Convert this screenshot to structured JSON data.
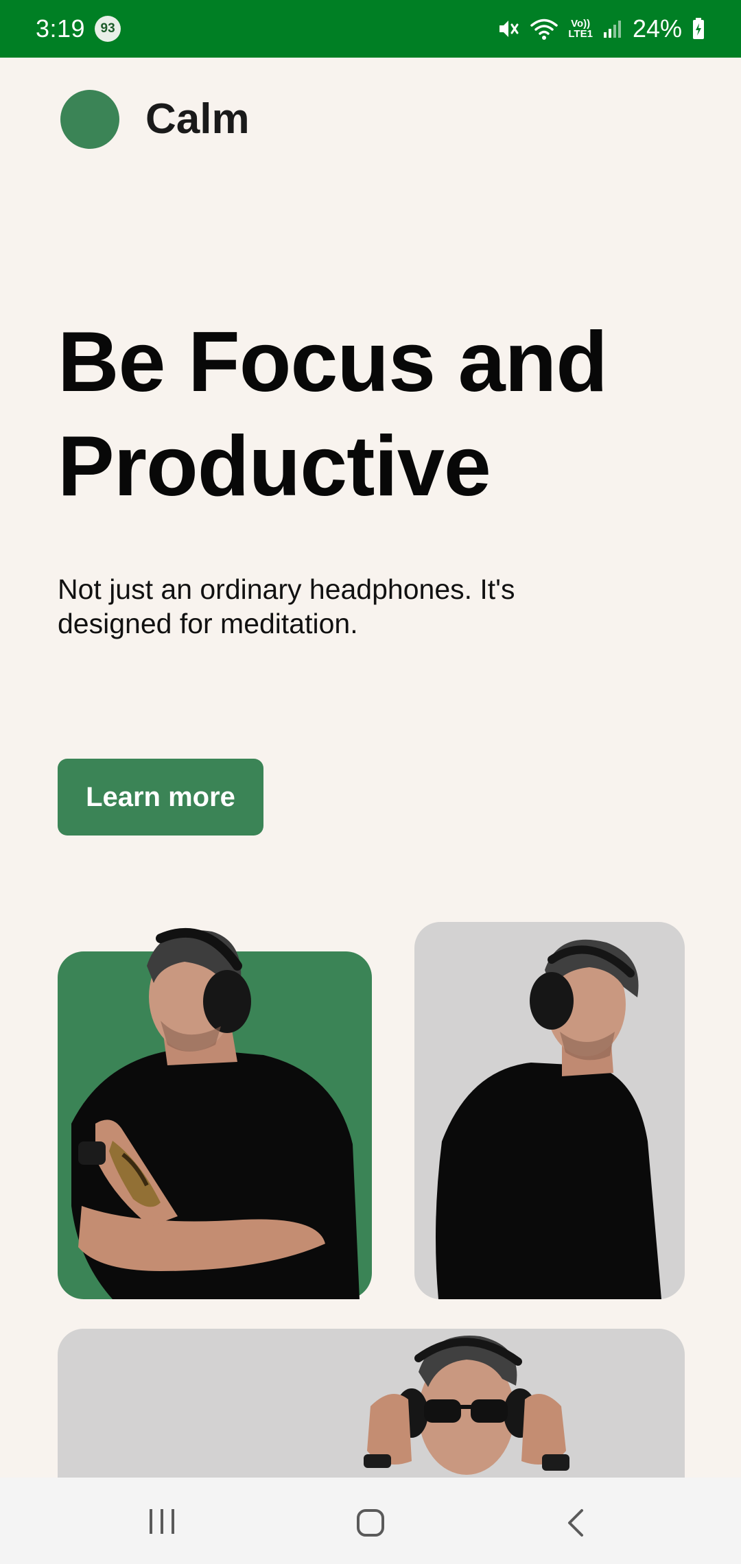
{
  "status_bar": {
    "time": "3:19",
    "notification_badge": "93",
    "volte_top": "Vo))",
    "volte_bottom": "LTE1",
    "battery": "24%",
    "icons": [
      "mute-icon",
      "wifi-icon",
      "signal-icon",
      "battery-charging-icon"
    ],
    "background_color": "#007f24"
  },
  "header": {
    "brand": "Calm",
    "logo_color": "#3b8456"
  },
  "hero": {
    "title_line1": "Be Focus and",
    "title_line2": "Productive",
    "subtitle_line1": "Not just an ordinary headphones. It's",
    "subtitle_line2": "designed for meditation.",
    "cta_label": "Learn more",
    "accent_color": "#3b8456"
  },
  "gallery": {
    "cards": [
      {
        "background": "#3b8456",
        "subject": "man with headphones, arms crossed"
      },
      {
        "background": "#d3d2d2",
        "subject": "man with headphones, looking down"
      },
      {
        "background": "#d3d2d2",
        "subject": "man with sunglasses adjusting headphones"
      }
    ]
  },
  "nav_bar": {
    "buttons": [
      "recent-apps-icon",
      "home-icon",
      "back-icon"
    ]
  }
}
